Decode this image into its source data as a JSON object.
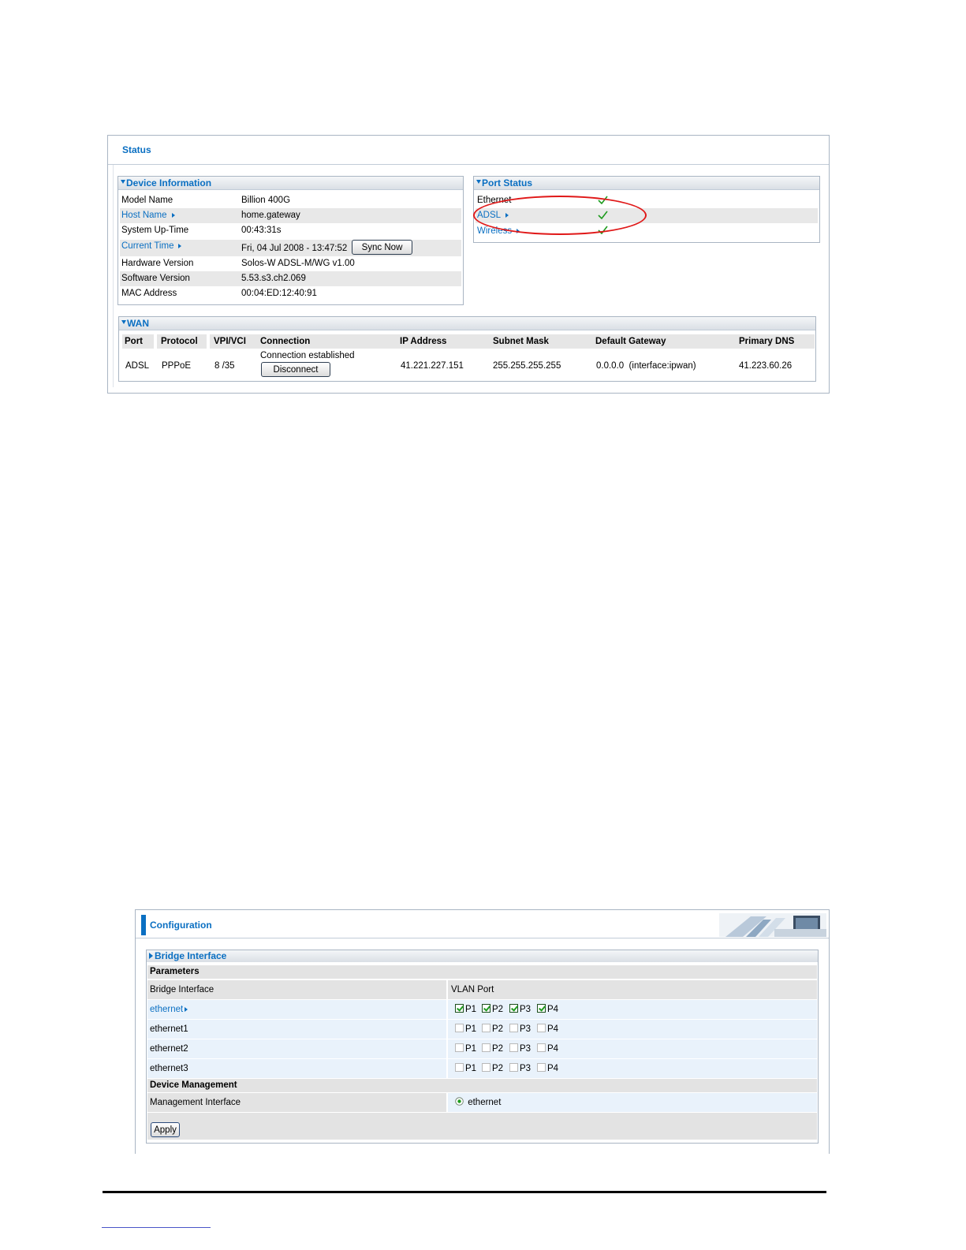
{
  "status": {
    "title": "Status",
    "device_information": {
      "heading": "Device Information",
      "rows": [
        {
          "label": "Model Name",
          "value": "Billion 400G"
        },
        {
          "label": "Host Name",
          "value": "home.gateway"
        },
        {
          "label": "System Up-Time",
          "value": "00:43:31s"
        },
        {
          "label": "Current Time",
          "value": "Fri, 04 Jul 2008 - 13:47:52"
        },
        {
          "label": "Hardware Version",
          "value": "Solos-W ADSL-M/WG v1.00"
        },
        {
          "label": "Software Version",
          "value": "5.53.s3.ch2.069"
        },
        {
          "label": "MAC Address",
          "value": "00:04:ED:12:40:91"
        }
      ],
      "sync_button": "Sync Now"
    },
    "port_status": {
      "heading": "Port Status",
      "rows": [
        {
          "label": "Ethernet",
          "ok": true
        },
        {
          "label": "ADSL",
          "ok": true
        },
        {
          "label": "Wireless",
          "ok": true
        }
      ],
      "highlight_color": "#e01818"
    },
    "wan": {
      "heading": "WAN",
      "columns": [
        "Port",
        "Protocol",
        "VPI/VCI",
        "Connection",
        "IP Address",
        "Subnet Mask",
        "Default Gateway",
        "Primary DNS"
      ],
      "row": {
        "port": "ADSL",
        "protocol": "PPPoE",
        "vpi_vci": "8 /35",
        "connection": "Connection established",
        "ip_address": "41.221.227.151",
        "subnet_mask": "255.255.255.255",
        "default_gateway": "0.0.0.0  (interface:ipwan)",
        "primary_dns": "41.223.60.26"
      },
      "disconnect_button": "Disconnect"
    }
  },
  "configuration": {
    "title": "Configuration",
    "section": "Bridge Interface",
    "parameters_label": "Parameters",
    "col_bridge": "Bridge Interface",
    "col_vlan": "VLAN Port",
    "interfaces": [
      {
        "name": "ethernet",
        "ports": [
          {
            "label": "P1",
            "checked": true
          },
          {
            "label": "P2",
            "checked": true
          },
          {
            "label": "P3",
            "checked": true
          },
          {
            "label": "P4",
            "checked": true
          }
        ]
      },
      {
        "name": "ethernet1",
        "ports": [
          {
            "label": "P1",
            "checked": false
          },
          {
            "label": "P2",
            "checked": false
          },
          {
            "label": "P3",
            "checked": false
          },
          {
            "label": "P4",
            "checked": false
          }
        ]
      },
      {
        "name": "ethernet2",
        "ports": [
          {
            "label": "P1",
            "checked": false
          },
          {
            "label": "P2",
            "checked": false
          },
          {
            "label": "P3",
            "checked": false
          },
          {
            "label": "P4",
            "checked": false
          }
        ]
      },
      {
        "name": "ethernet3",
        "ports": [
          {
            "label": "P1",
            "checked": false
          },
          {
            "label": "P2",
            "checked": false
          },
          {
            "label": "P3",
            "checked": false
          },
          {
            "label": "P4",
            "checked": false
          }
        ]
      }
    ],
    "device_management_label": "Device Management",
    "management_interface_label": "Management Interface",
    "management_interface_value": "ethernet",
    "apply_button": "Apply"
  },
  "colors": {
    "accent": "#0a6fc2",
    "row_shade": "#e8e8e8",
    "check_green": "#1e9b1e"
  }
}
